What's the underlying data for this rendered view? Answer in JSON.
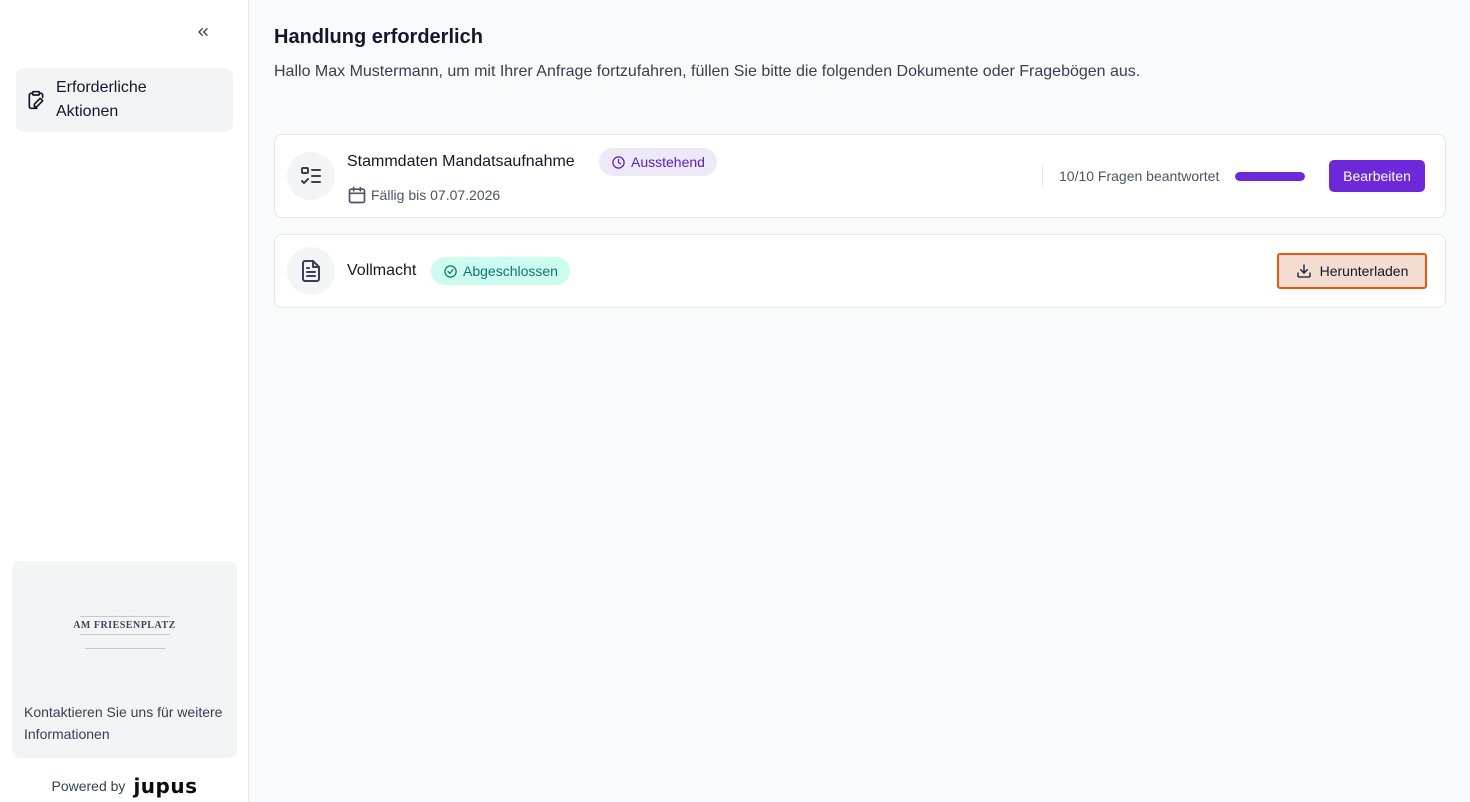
{
  "sidebar": {
    "collapse_icon": "chevrons-left-icon",
    "nav_items": [
      {
        "label": "Erforderliche Aktionen",
        "icon": "clipboard-sign-icon",
        "active": true
      }
    ],
    "contact": {
      "logo_title": "AM FRIESENPLATZ",
      "text": "Kontaktieren Sie uns für weitere Informationen"
    },
    "powered_by": {
      "label": "Powered by",
      "brand": "jupus"
    }
  },
  "main": {
    "title": "Handlung erforderlich",
    "subtitle": "Hallo Max Mustermann, um mit Ihrer Anfrage fortzufahren, füllen Sie bitte die folgenden Dokumente oder Fragebögen aus.",
    "tasks": [
      {
        "title": "Stammdaten Mandatsaufnahme",
        "icon": "list-checks-icon",
        "status": "Ausstehend",
        "status_icon": "clock-icon",
        "due": "Fällig bis 07.07.2026",
        "progress_text": "10/10 Fragen beantwortet",
        "progress": 1.0,
        "action": "Bearbeiten"
      },
      {
        "title": "Vollmacht",
        "icon": "file-text-icon",
        "status": "Abgeschlossen",
        "status_icon": "check-circle-icon",
        "action": "Herunterladen",
        "action_icon": "download-icon"
      }
    ]
  },
  "colors": {
    "accent": "#6d28d9",
    "pending_bg": "#ede9f6",
    "done_bg": "#ccfbef",
    "download_border": "#ea580c"
  }
}
